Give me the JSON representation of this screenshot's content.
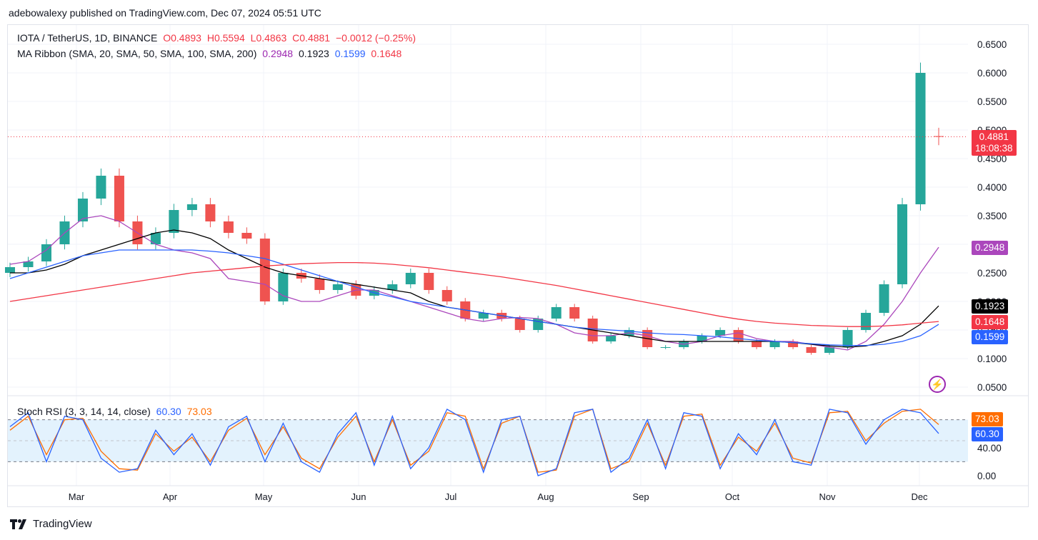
{
  "publisher": "adebowalexy published on TradingView.com, Dec 07, 2024 05:51 UTC",
  "legend": {
    "symbol": "IOTA / TetherUS, 1D, BINANCE",
    "open": "O0.4893",
    "high": "H0.5594",
    "low": "L0.4863",
    "close": "C0.4881",
    "change": "−0.0012 (−0.25%)",
    "ma_label": "MA Ribbon (SMA, 20, SMA, 50, SMA, 100, SMA, 200)",
    "ma20": "0.2948",
    "ma50": "0.1923",
    "ma100": "0.1599",
    "ma200": "0.1648",
    "rsi_label": "Stoch RSI (3, 3, 14, 14, close)",
    "rsi_k": "60.30",
    "rsi_d": "73.03"
  },
  "price_tag": {
    "price": "0.4881",
    "countdown": "18:08:38"
  },
  "ma_tags": {
    "ma20": "0.2948",
    "ma50": "0.1923",
    "ma200": "0.1648",
    "ma100": "0.1599"
  },
  "rsi_tags": {
    "d": "73.03",
    "k": "60.30"
  },
  "colors": {
    "up": "#26a69a",
    "down": "#ef5350",
    "ma20": "#ab47bc",
    "ma50": "#000000",
    "ma100": "#2962ff",
    "ma200": "#f23645",
    "stoch_k": "#2962ff",
    "stoch_d": "#ff6d00",
    "rsi_band": "#e3f2fd"
  },
  "brand": "TradingView",
  "chart_data": {
    "type": "candlestick",
    "x_ticks": [
      "Mar",
      "Apr",
      "May",
      "Jun",
      "Jul",
      "Aug",
      "Sep",
      "Oct",
      "Nov",
      "Dec"
    ],
    "y_ticks": [
      "0.6500",
      "0.6000",
      "0.5500",
      "0.5000",
      "0.4500",
      "0.4000",
      "0.3500",
      "0.3000",
      "0.2500",
      "0.2000",
      "0.1500",
      "0.1000",
      "0.0500"
    ],
    "ylim": [
      0.05,
      0.65
    ],
    "rsi_ticks": [
      "0.00",
      "40.00"
    ],
    "rsi_ylim": [
      0,
      100
    ],
    "rsi_bands": [
      20,
      80
    ],
    "last_price": 0.4881,
    "series": [
      {
        "name": "SMA 20",
        "values": [
          0.265,
          0.27,
          0.29,
          0.32,
          0.345,
          0.35,
          0.34,
          0.32,
          0.3,
          0.29,
          0.285,
          0.275,
          0.24,
          0.235,
          0.23,
          0.21,
          0.2,
          0.2,
          0.21,
          0.22,
          0.22,
          0.21,
          0.2,
          0.19,
          0.18,
          0.17,
          0.165,
          0.17,
          0.172,
          0.17,
          0.16,
          0.145,
          0.14,
          0.14,
          0.145,
          0.14,
          0.13,
          0.125,
          0.13,
          0.14,
          0.145,
          0.135,
          0.13,
          0.13,
          0.125,
          0.12,
          0.115,
          0.13,
          0.16,
          0.2,
          0.25,
          0.2948
        ]
      },
      {
        "name": "SMA 50",
        "values": [
          0.25,
          0.25,
          0.255,
          0.265,
          0.28,
          0.29,
          0.3,
          0.31,
          0.32,
          0.325,
          0.32,
          0.31,
          0.29,
          0.275,
          0.26,
          0.25,
          0.245,
          0.24,
          0.235,
          0.23,
          0.225,
          0.22,
          0.215,
          0.2,
          0.19,
          0.185,
          0.18,
          0.175,
          0.17,
          0.165,
          0.16,
          0.155,
          0.15,
          0.145,
          0.14,
          0.135,
          0.13,
          0.13,
          0.13,
          0.13,
          0.13,
          0.13,
          0.13,
          0.128,
          0.125,
          0.122,
          0.12,
          0.122,
          0.13,
          0.14,
          0.16,
          0.1923
        ]
      },
      {
        "name": "SMA 100",
        "values": [
          0.24,
          0.25,
          0.26,
          0.27,
          0.28,
          0.285,
          0.29,
          0.29,
          0.29,
          0.29,
          0.29,
          0.288,
          0.285,
          0.28,
          0.275,
          0.265,
          0.255,
          0.245,
          0.235,
          0.225,
          0.215,
          0.208,
          0.2,
          0.195,
          0.19,
          0.185,
          0.18,
          0.175,
          0.17,
          0.165,
          0.16,
          0.155,
          0.152,
          0.15,
          0.148,
          0.145,
          0.143,
          0.142,
          0.14,
          0.138,
          0.135,
          0.132,
          0.13,
          0.128,
          0.126,
          0.124,
          0.123,
          0.123,
          0.125,
          0.13,
          0.14,
          0.1599
        ]
      },
      {
        "name": "SMA 200",
        "values": [
          0.2,
          0.205,
          0.21,
          0.215,
          0.22,
          0.225,
          0.23,
          0.235,
          0.24,
          0.245,
          0.25,
          0.253,
          0.256,
          0.259,
          0.262,
          0.264,
          0.266,
          0.267,
          0.268,
          0.268,
          0.267,
          0.265,
          0.262,
          0.259,
          0.255,
          0.251,
          0.247,
          0.243,
          0.238,
          0.233,
          0.228,
          0.222,
          0.216,
          0.21,
          0.204,
          0.198,
          0.192,
          0.186,
          0.18,
          0.174,
          0.169,
          0.165,
          0.162,
          0.16,
          0.158,
          0.157,
          0.156,
          0.156,
          0.157,
          0.159,
          0.162,
          0.1648
        ]
      }
    ],
    "candles": [
      [
        0.25,
        0.26
      ],
      [
        0.26,
        0.27
      ],
      [
        0.27,
        0.3
      ],
      [
        0.3,
        0.34
      ],
      [
        0.34,
        0.38
      ],
      [
        0.38,
        0.42
      ],
      [
        0.42,
        0.34
      ],
      [
        0.34,
        0.3
      ],
      [
        0.3,
        0.32
      ],
      [
        0.32,
        0.36
      ],
      [
        0.36,
        0.37
      ],
      [
        0.37,
        0.34
      ],
      [
        0.34,
        0.32
      ],
      [
        0.32,
        0.31
      ],
      [
        0.31,
        0.2
      ],
      [
        0.2,
        0.25
      ],
      [
        0.25,
        0.24
      ],
      [
        0.24,
        0.22
      ],
      [
        0.22,
        0.23
      ],
      [
        0.23,
        0.21
      ],
      [
        0.21,
        0.22
      ],
      [
        0.22,
        0.23
      ],
      [
        0.23,
        0.25
      ],
      [
        0.25,
        0.22
      ],
      [
        0.22,
        0.2
      ],
      [
        0.2,
        0.17
      ],
      [
        0.17,
        0.18
      ],
      [
        0.18,
        0.17
      ],
      [
        0.17,
        0.15
      ],
      [
        0.15,
        0.17
      ],
      [
        0.17,
        0.19
      ],
      [
        0.19,
        0.17
      ],
      [
        0.17,
        0.13
      ],
      [
        0.13,
        0.14
      ],
      [
        0.14,
        0.15
      ],
      [
        0.15,
        0.12
      ],
      [
        0.12,
        0.12
      ],
      [
        0.12,
        0.13
      ],
      [
        0.13,
        0.14
      ],
      [
        0.14,
        0.15
      ],
      [
        0.15,
        0.13
      ],
      [
        0.13,
        0.12
      ],
      [
        0.12,
        0.13
      ],
      [
        0.13,
        0.12
      ],
      [
        0.12,
        0.11
      ],
      [
        0.11,
        0.12
      ],
      [
        0.12,
        0.15
      ],
      [
        0.15,
        0.18
      ],
      [
        0.18,
        0.23
      ],
      [
        0.23,
        0.37
      ],
      [
        0.37,
        0.6
      ],
      [
        0.4893,
        0.4881
      ]
    ],
    "stoch_k": [
      70,
      90,
      20,
      85,
      80,
      25,
      5,
      10,
      65,
      30,
      60,
      15,
      70,
      85,
      20,
      75,
      20,
      5,
      60,
      90,
      15,
      85,
      10,
      40,
      95,
      80,
      5,
      80,
      85,
      0,
      10,
      90,
      95,
      5,
      25,
      80,
      10,
      90,
      85,
      10,
      60,
      30,
      80,
      20,
      15,
      95,
      90,
      45,
      80,
      95,
      90,
      60.3
    ],
    "stoch_d": [
      65,
      85,
      30,
      80,
      82,
      35,
      10,
      8,
      60,
      35,
      55,
      20,
      65,
      82,
      30,
      70,
      25,
      10,
      55,
      85,
      20,
      80,
      15,
      35,
      90,
      85,
      10,
      75,
      85,
      5,
      8,
      85,
      95,
      10,
      20,
      75,
      15,
      85,
      88,
      15,
      55,
      35,
      75,
      25,
      18,
      90,
      92,
      50,
      75,
      92,
      95,
      73.03
    ]
  }
}
